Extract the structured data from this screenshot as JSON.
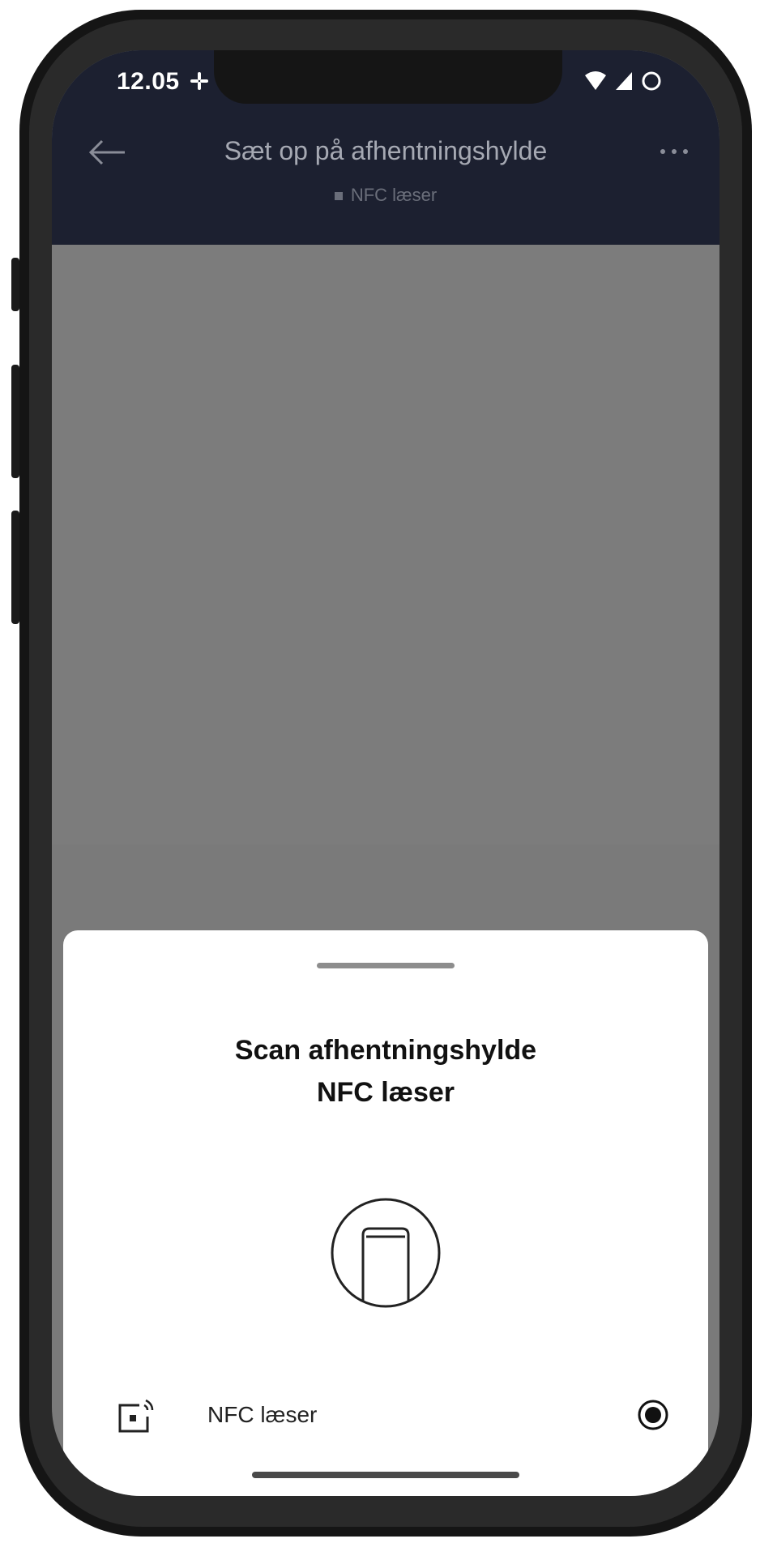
{
  "status_bar": {
    "time": "12.05",
    "icons": [
      "slack-icon",
      "wifi-icon",
      "signal-icon",
      "loading-icon"
    ]
  },
  "app_bar": {
    "title": "Sæt op på afhentningshylde",
    "subtitle": "NFC læser",
    "back_icon": "back-arrow-icon",
    "more_icon": "more-icon"
  },
  "sheet": {
    "title_line1": "Scan afhentningshylde",
    "title_line2": "NFC læser",
    "illustration": "nfc-reader-icon",
    "options": [
      {
        "label": "NFC læser",
        "icon": "nfc-icon",
        "selected": true
      }
    ]
  },
  "colors": {
    "app_bar_bg": "#1c2030",
    "overlay": "#7c7c7c",
    "sheet_bg": "#ffffff",
    "text_primary": "#111111"
  }
}
